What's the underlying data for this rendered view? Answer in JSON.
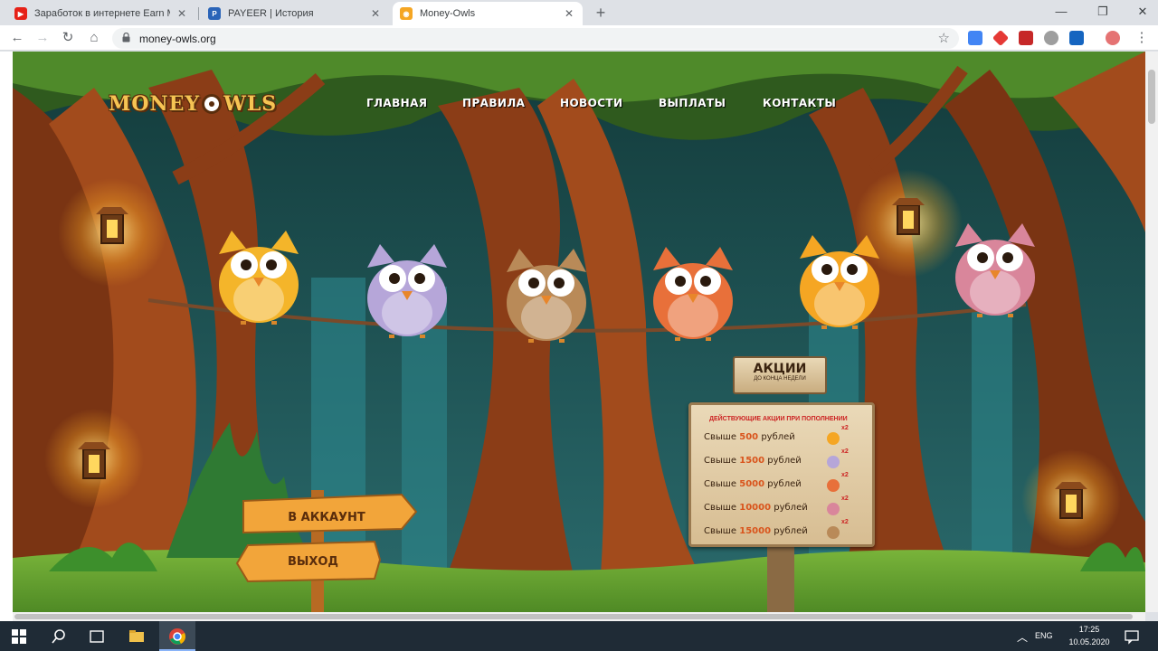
{
  "browser": {
    "tabs": [
      {
        "title": "Заработок в интернете Earn Mo",
        "icon": "youtube-icon"
      },
      {
        "title": "PAYEER | История",
        "icon": "payeer-icon"
      },
      {
        "title": "Money-Owls",
        "icon": "owl-icon"
      }
    ],
    "url": "money-owls.org"
  },
  "site": {
    "logo": {
      "left": "MONEY",
      "right": "WLS"
    },
    "nav": [
      "ГЛАВНАЯ",
      "ПРАВИЛА",
      "НОВОСТИ",
      "ВЫПЛАТЫ",
      "КОНТАКТЫ"
    ],
    "signs": {
      "account": "В АККАУНТ",
      "logout": "ВЫХОД"
    },
    "promo": {
      "title": "АКЦИИ",
      "subtitle": "ДО КОНЦА НЕДЕЛИ",
      "header": "ДЕЙСТВУЮЩИЕ АКЦИИ ПРИ ПОПОЛНЕНИИ",
      "rows": [
        {
          "prefix": "Свыше",
          "amount": "500",
          "suffix": "рублей",
          "bonus": "x2"
        },
        {
          "prefix": "Свыше",
          "amount": "1500",
          "suffix": "рублей",
          "bonus": "x2"
        },
        {
          "prefix": "Свыше",
          "amount": "5000",
          "suffix": "рублей",
          "bonus": "x2"
        },
        {
          "prefix": "Свыше",
          "amount": "10000",
          "suffix": "рублей",
          "bonus": "x2"
        },
        {
          "prefix": "Свыше",
          "amount": "15000",
          "suffix": "рублей",
          "bonus": "x2"
        }
      ]
    },
    "owl_colors": [
      "#f4b52a",
      "#b6a6d9",
      "#b98a58",
      "#e8703a",
      "#f5a623",
      "#d9869b"
    ]
  },
  "taskbar": {
    "lang": "ENG",
    "time": "17:25",
    "date": "10.05.2020"
  }
}
